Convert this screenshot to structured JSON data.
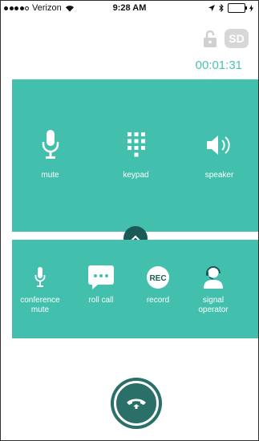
{
  "status_bar": {
    "carrier": "Verizon",
    "time": "9:28 AM",
    "signal_dots_filled": 4,
    "signal_dots_total": 5
  },
  "header": {
    "sd_badge": "SD",
    "timer": "00:01:31"
  },
  "controls_top": [
    {
      "label": "mute",
      "icon": "microphone-icon"
    },
    {
      "label": "keypad",
      "icon": "keypad-icon"
    },
    {
      "label": "speaker",
      "icon": "speaker-icon"
    }
  ],
  "controls_bottom": [
    {
      "label": "conference\nmute",
      "icon": "microphone-icon"
    },
    {
      "label": "roll call",
      "icon": "chat-bubble-icon"
    },
    {
      "label": "record",
      "icon": "rec-icon",
      "icon_text": "REC"
    },
    {
      "label": "signal\noperator",
      "icon": "operator-icon"
    }
  ],
  "colors": {
    "panel": "#43c0ad",
    "accent_text": "#4cc1b0",
    "dark_teal": "#2b6f69"
  }
}
